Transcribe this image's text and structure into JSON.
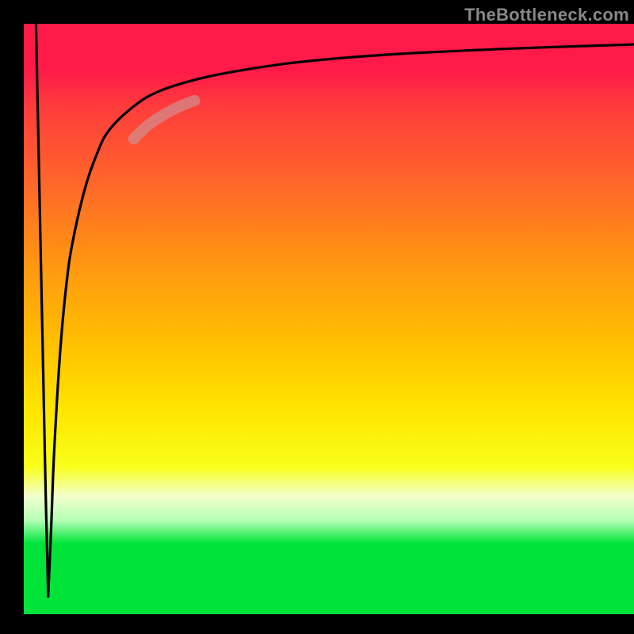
{
  "watermark": "TheBottleneck.com",
  "chart_data": {
    "type": "line",
    "title": "",
    "xlabel": "",
    "ylabel": "",
    "xlim": [
      0,
      100
    ],
    "ylim": [
      0,
      100
    ],
    "grid": false,
    "legend": false,
    "background_gradient": [
      "#ff1a4a",
      "#ff6a28",
      "#ffc300",
      "#f8ff1a",
      "#00e43a"
    ],
    "series": [
      {
        "name": "curve-descent",
        "color": "#000000",
        "x": [
          2.0,
          2.4,
          2.8,
          3.2,
          3.6,
          4.0
        ],
        "y": [
          100,
          80,
          60,
          40,
          20,
          3
        ]
      },
      {
        "name": "curve-ascent",
        "color": "#000000",
        "x": [
          4.0,
          4.5,
          5.0,
          6.0,
          7.0,
          8.0,
          10.0,
          12.0,
          14.0,
          18.0,
          22.0,
          28.0,
          35.0,
          45.0,
          60.0,
          80.0,
          100.0
        ],
        "y": [
          3,
          15,
          28,
          45,
          56,
          63,
          72,
          78,
          82,
          86,
          88.5,
          90.5,
          92,
          93.5,
          94.8,
          95.8,
          96.5
        ]
      },
      {
        "name": "highlight-segment",
        "color": "#d48a8a",
        "x": [
          18.0,
          20.0,
          22.0,
          24.0,
          26.0,
          28.0
        ],
        "y": [
          80.5,
          82.5,
          84.0,
          85.2,
          86.2,
          87.0
        ]
      }
    ],
    "notes": "No axis tick labels or numeric annotations are visible; values are estimated from relative position in the plot area."
  }
}
